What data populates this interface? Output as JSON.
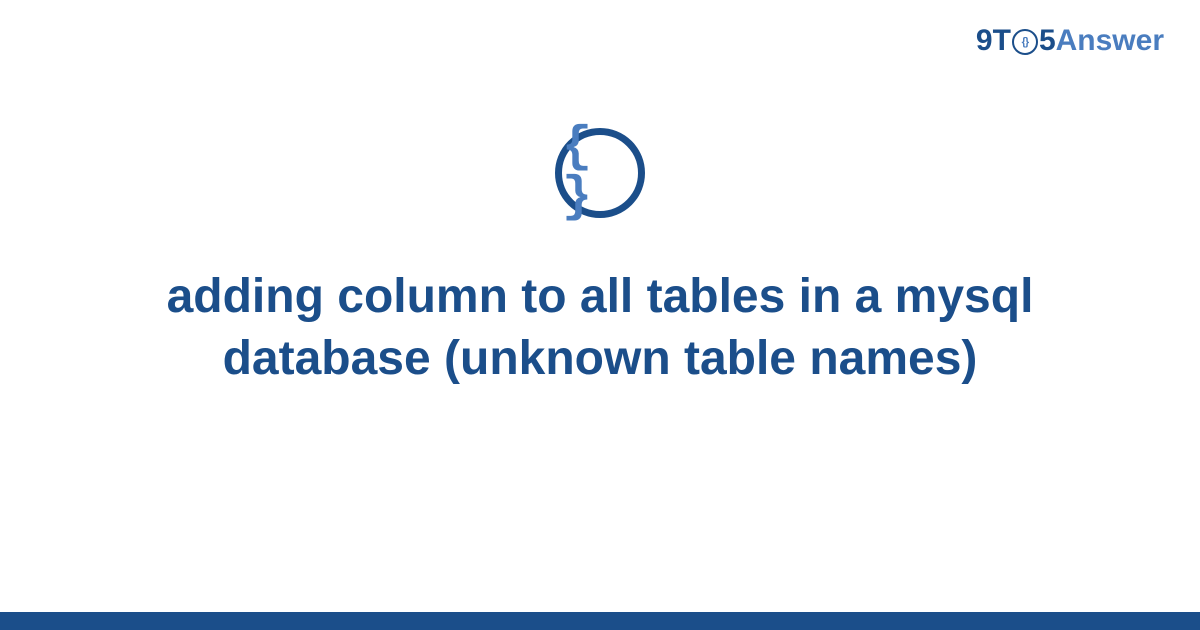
{
  "logo": {
    "part1": "9T",
    "circle_inner": "{}",
    "part2": "5",
    "part3": "Answer"
  },
  "icon": {
    "braces": "{ }"
  },
  "title": "adding column to all tables in a mysql database (unknown table names)",
  "colors": {
    "dark_blue": "#1b4e8a",
    "light_blue": "#4a7dbf"
  }
}
